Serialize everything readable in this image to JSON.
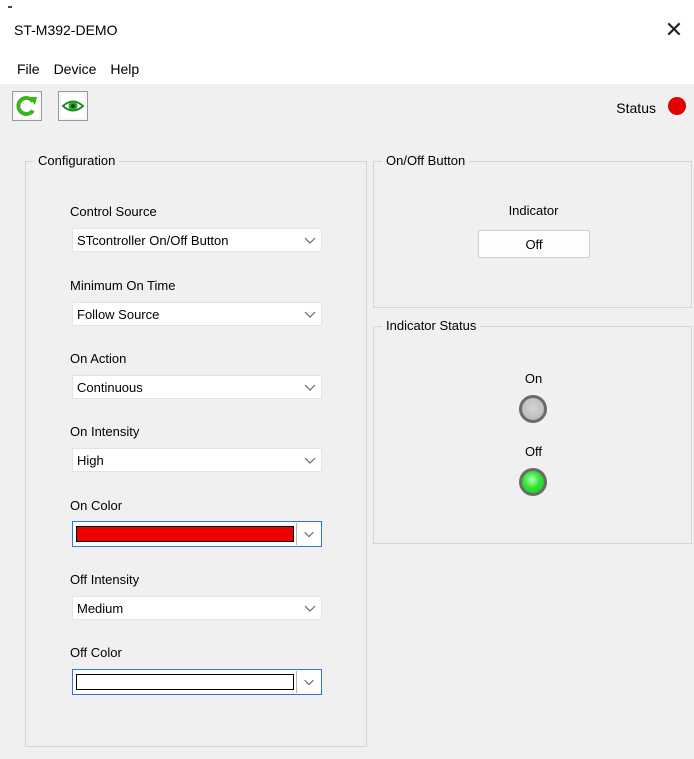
{
  "window": {
    "title": "ST-M392-DEMO",
    "close_glyph": "✕"
  },
  "menu": {
    "items": [
      "File",
      "Device",
      "Help"
    ]
  },
  "toolbar": {
    "refresh_icon": "refresh-icon",
    "view_icon": "eye-icon",
    "status_label": "Status",
    "status_color": "#e30000"
  },
  "configuration": {
    "title": "Configuration",
    "fields": [
      {
        "label": "Control Source",
        "value": "STcontroller On/Off Button"
      },
      {
        "label": "Minimum On Time",
        "value": "Follow Source"
      },
      {
        "label": "On Action",
        "value": "Continuous"
      },
      {
        "label": "On Intensity",
        "value": "High"
      },
      {
        "label": "On Color",
        "color": "#ee0000"
      },
      {
        "label": "Off Intensity",
        "value": "Medium"
      },
      {
        "label": "Off Color",
        "color": "#ffffff"
      }
    ]
  },
  "onoff_button": {
    "title": "On/Off Button",
    "indicator_label": "Indicator",
    "button_label": "Off"
  },
  "indicator_status": {
    "title": "Indicator Status",
    "on_label": "On",
    "on_color": "#c2c2c2",
    "off_label": "Off",
    "off_color": "#33e233"
  }
}
